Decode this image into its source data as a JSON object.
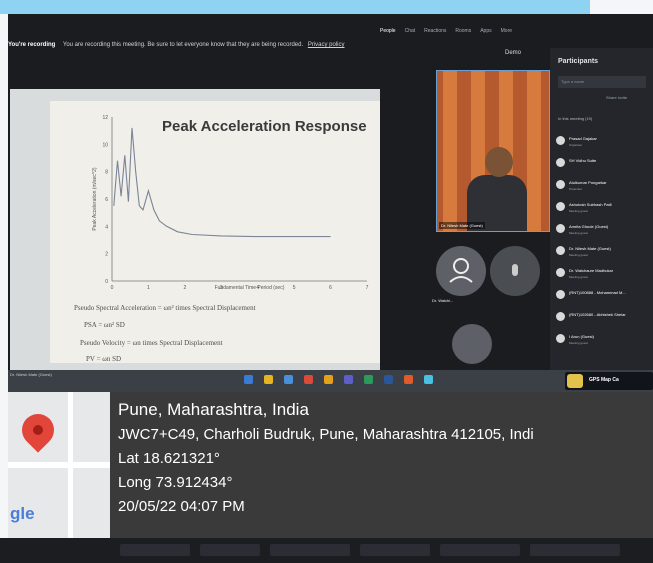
{
  "meeting": {
    "recording_title": "You're recording",
    "recording_message": "You are recording this meeting. Be sure to let everyone know that they are being recorded.",
    "privacy_link": "Privacy policy",
    "demo_label": "Demo"
  },
  "slide": {
    "title": "Peak Acceleration Response",
    "formula1": "Pseudo Spectral Acceleration = ωn² times Spectral Displacement",
    "formula2": "PSA = ωn² SD",
    "formula3": "Pseudo Velocity = ωn times Spectral Displacement",
    "formula4": "PV = ωn SD"
  },
  "chart_data": {
    "type": "line",
    "title": "Peak Acceleration Response",
    "xlabel": "Fundamental Time Period (sec)",
    "ylabel": "Peak Acceleration (m/sec^2)",
    "xlim": [
      0,
      7
    ],
    "ylim": [
      0,
      12
    ],
    "x_ticks": [
      "0",
      "1",
      "2",
      "3",
      "4",
      "5",
      "6",
      "7"
    ],
    "y_ticks": [
      "0",
      "2",
      "4",
      "6",
      "8",
      "10",
      "12"
    ],
    "series": [
      {
        "x": [
          0.05,
          0.15,
          0.25,
          0.35,
          0.45,
          0.55,
          0.65,
          0.75,
          0.85,
          1.0,
          1.15,
          1.3,
          1.5,
          1.8,
          2.2,
          3.0,
          4.0,
          5.0,
          6.0
        ],
        "values": [
          5.5,
          8.8,
          6.2,
          9.2,
          5.8,
          11.2,
          8.0,
          5.5,
          5.2,
          6.6,
          5.2,
          4.4,
          4.0,
          3.6,
          3.4,
          3.3,
          3.25,
          3.25,
          3.25
        ]
      }
    ]
  },
  "participants": {
    "title": "Participants",
    "search_placeholder": "Type a name",
    "invite_label": "Share invite",
    "section_label": "In this meeting (19)",
    "camera_name": "Dr. Nilesh Mate (Guest)",
    "tile1_label": "Dr. Walchi...",
    "list": [
      {
        "name": "Prasad Gajakar",
        "role": "Organiser"
      },
      {
        "name": "SH Vidhu Sutte",
        "role": ""
      },
      {
        "name": "Atulkumar Pongarkar",
        "role": "Presenter"
      },
      {
        "name": "Ashutosh Subhash Patil",
        "role": "Meeting guest"
      },
      {
        "name": "Amrita Ghude (Guest)",
        "role": "Meeting guest"
      },
      {
        "name": "Dr. Nilesh Mate (Guest)",
        "role": "Meeting guest"
      },
      {
        "name": "Dr. Walchaure Madhukar",
        "role": "Meeting guest"
      },
      {
        "name": "(RNT)100888 - Mohammad M...",
        "role": ""
      },
      {
        "name": "(RNT)102680 - Abhishek Shelar",
        "role": ""
      },
      {
        "name": "I Arun (Guest)",
        "role": "Meeting guest"
      }
    ]
  },
  "taskbar": {
    "left_label": "Dr. Nilesh Mate (Guest)",
    "gps_app_label": "GPS Map Ca"
  },
  "gps": {
    "city": "Pune, Maharashtra, India",
    "address": "JWC7+C49, Charholi Budruk, Pune, Maharashtra 412105, Indi",
    "lat": "Lat 18.621321°",
    "long": "Long 73.912434°",
    "datetime": "20/05/22 04:07 PM",
    "logo": "gle"
  },
  "colors": {
    "chart_line": "#7a8596",
    "pin": "#e2463a",
    "overlay_bg": "#3a3a3a",
    "top_strip": "#8fd3f2"
  }
}
